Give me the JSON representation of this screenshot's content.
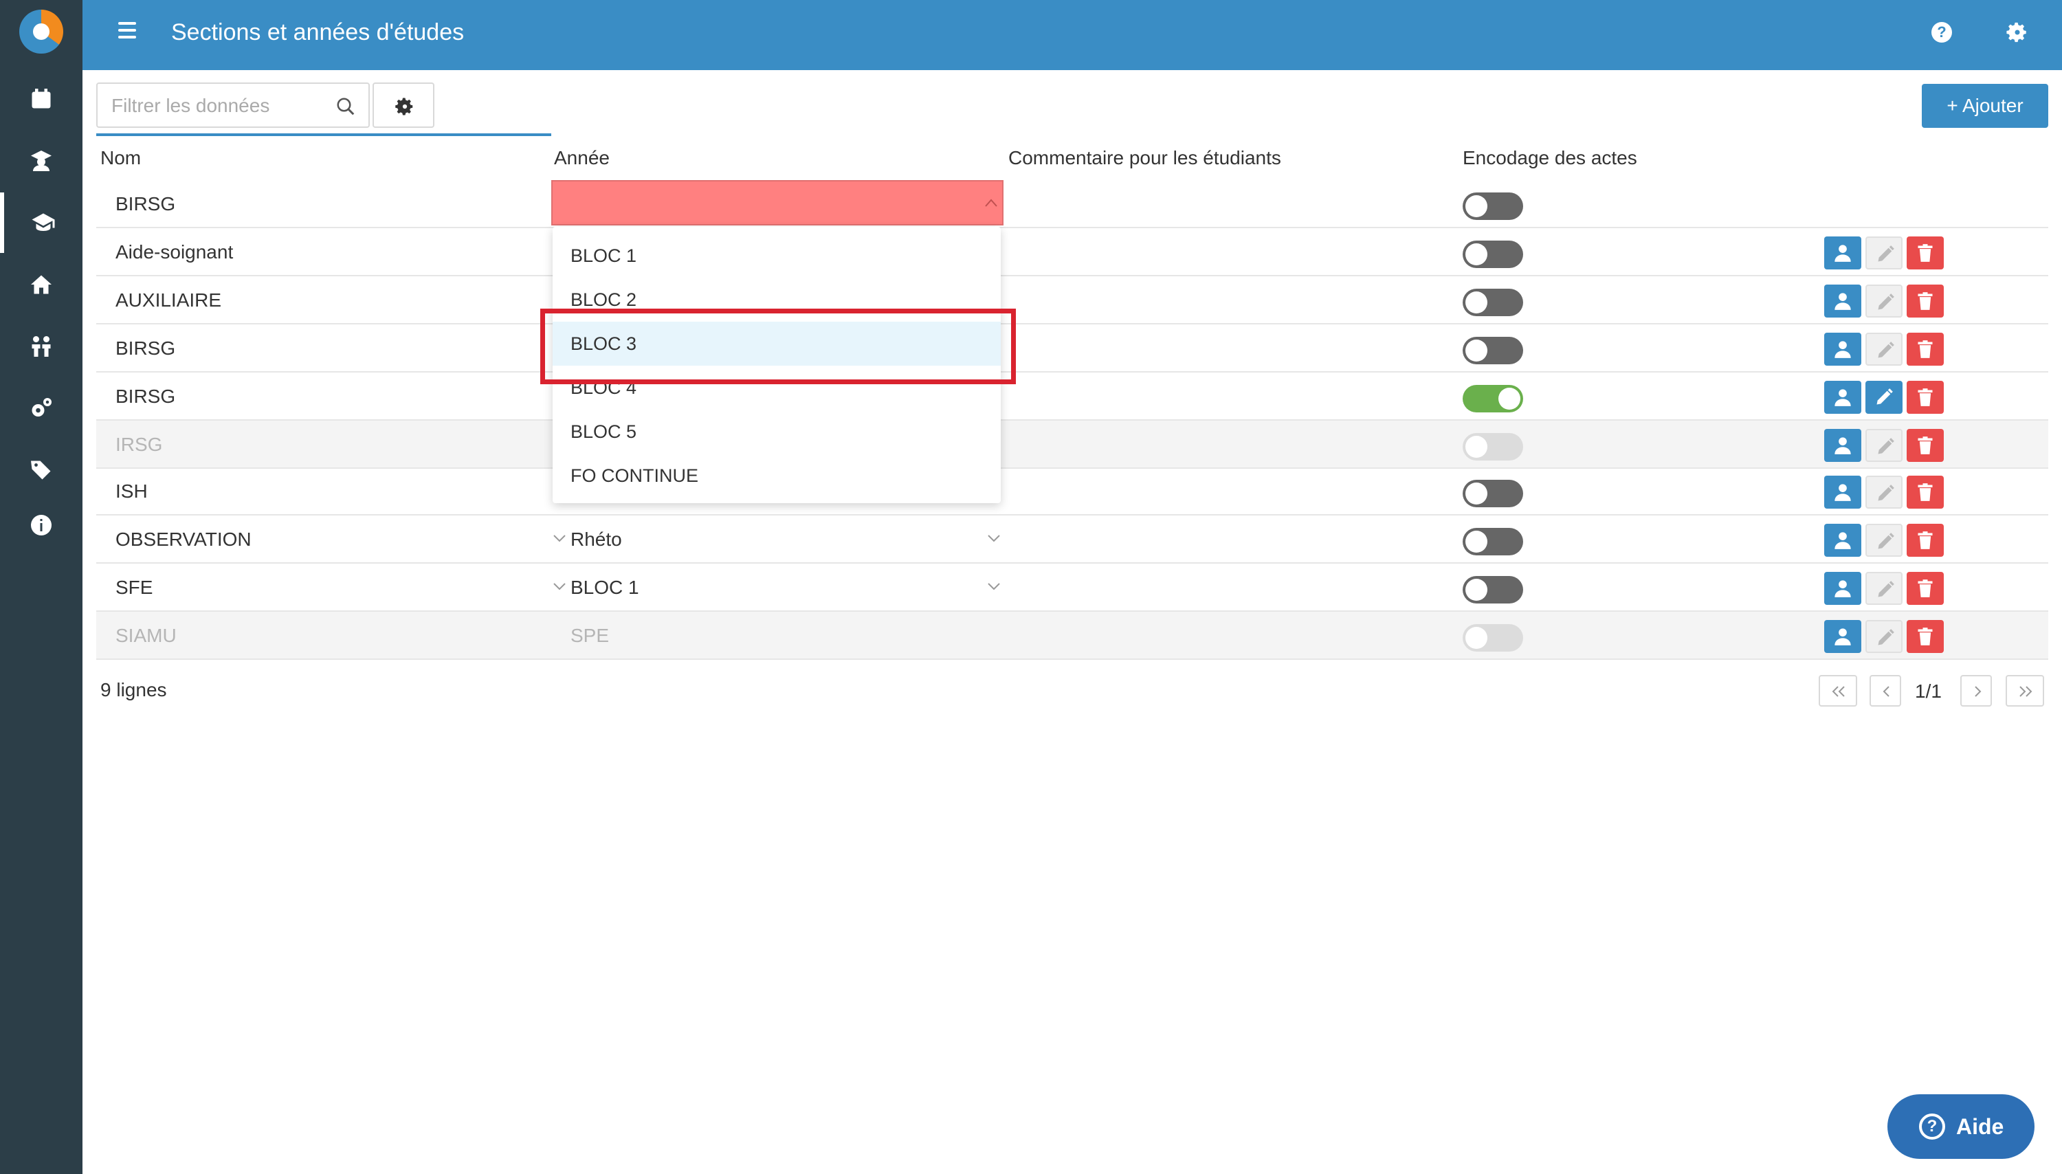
{
  "header": {
    "title": "Sections et années d'études"
  },
  "toolbar": {
    "search_placeholder": "Filtrer les données",
    "add_label": "Ajouter"
  },
  "columns": {
    "nom": "Nom",
    "annee": "Année",
    "commentaire": "Commentaire pour les étudiants",
    "encodage": "Encodage des actes"
  },
  "rows": [
    {
      "nom": "BIRSG",
      "annee": "",
      "encodage": false,
      "disabled": false,
      "editing": true
    },
    {
      "nom": "Aide-soignant",
      "annee": "",
      "encodage": false,
      "disabled": false
    },
    {
      "nom": "AUXILIAIRE",
      "annee": "",
      "encodage": false,
      "disabled": false
    },
    {
      "nom": "BIRSG",
      "annee": "",
      "encodage": false,
      "disabled": false
    },
    {
      "nom": "BIRSG",
      "annee": "",
      "encodage": true,
      "disabled": false
    },
    {
      "nom": "IRSG",
      "annee": "",
      "encodage": false,
      "disabled": true
    },
    {
      "nom": "ISH",
      "annee": "",
      "encodage": false,
      "disabled": false
    },
    {
      "nom": "OBSERVATION",
      "annee": "Rhéto",
      "encodage": false,
      "disabled": false
    },
    {
      "nom": "SFE",
      "annee": "BLOC 1",
      "encodage": false,
      "disabled": false
    },
    {
      "nom": "SIAMU",
      "annee": "SPE",
      "encodage": false,
      "disabled": true
    }
  ],
  "dropdown": {
    "options": [
      "BLOC 1",
      "BLOC 2",
      "BLOC 3",
      "BLOC 4",
      "BLOC 5",
      "FO CONTINUE"
    ],
    "hovered": "BLOC 3"
  },
  "footer": {
    "rows_count": "9 lignes",
    "page": "1/1"
  },
  "help": {
    "label": "Aide"
  },
  "colors": {
    "primary": "#3a8dc5",
    "sidebar": "#2c3e48",
    "danger": "#e94b4b",
    "toggle_on": "#6ab04c",
    "error_field": "#ff8080",
    "highlight": "#d9232f"
  }
}
